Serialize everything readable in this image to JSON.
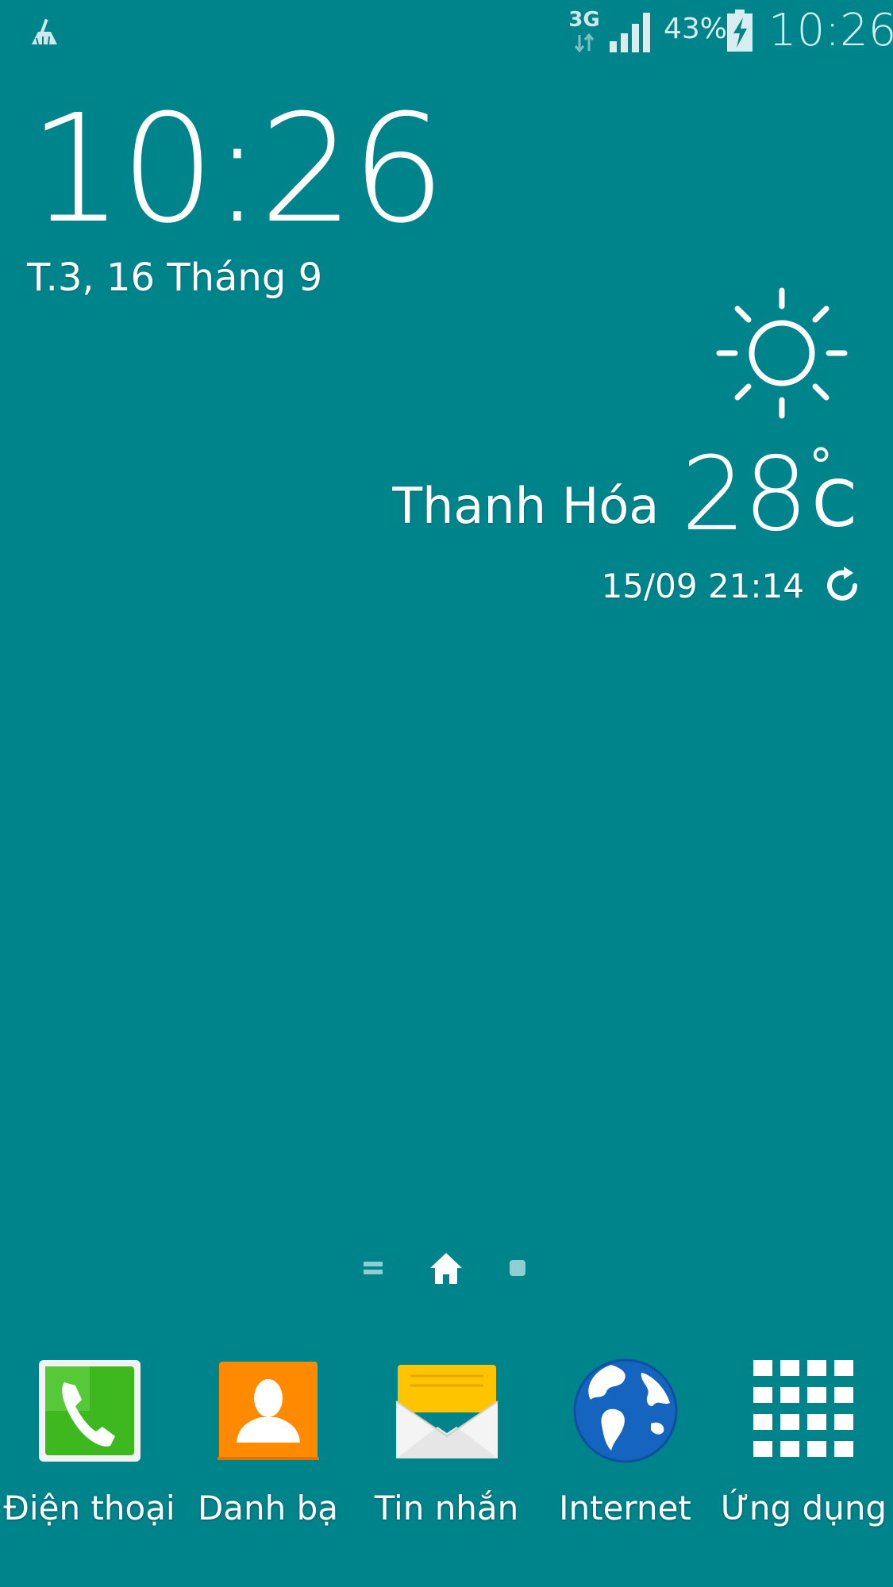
{
  "status_bar": {
    "network_type": "3G",
    "battery_percent": "43%",
    "time": "10:26",
    "icons": [
      "clean-master-icon",
      "data-3g-icon",
      "signal-strength-icon",
      "battery-charging-icon"
    ]
  },
  "clock_widget": {
    "time": "10:26",
    "date": "T.3, 16 Tháng 9"
  },
  "weather_widget": {
    "icon": "sun-icon",
    "city": "Thanh Hóa",
    "temperature": "28",
    "unit": "C",
    "degree_symbol": "°",
    "updated": "15/09 21:14"
  },
  "page_indicator": {
    "pages": [
      "menu",
      "home",
      "page-2"
    ],
    "current": "home"
  },
  "dock": {
    "items": [
      {
        "label": "Điện thoại",
        "icon": "phone-icon"
      },
      {
        "label": "Danh bạ",
        "icon": "contacts-icon"
      },
      {
        "label": "Tin nhắn",
        "icon": "messages-icon"
      },
      {
        "label": "Internet",
        "icon": "internet-globe-icon"
      },
      {
        "label": "Ứng dụng",
        "icon": "app-drawer-icon"
      }
    ]
  },
  "colors": {
    "wallpaper": "#00848C",
    "phone_green": "#3DB81F",
    "contacts_orange": "#FF8A00",
    "messages_yellow": "#FFC400",
    "globe_blue": "#1565C0"
  }
}
